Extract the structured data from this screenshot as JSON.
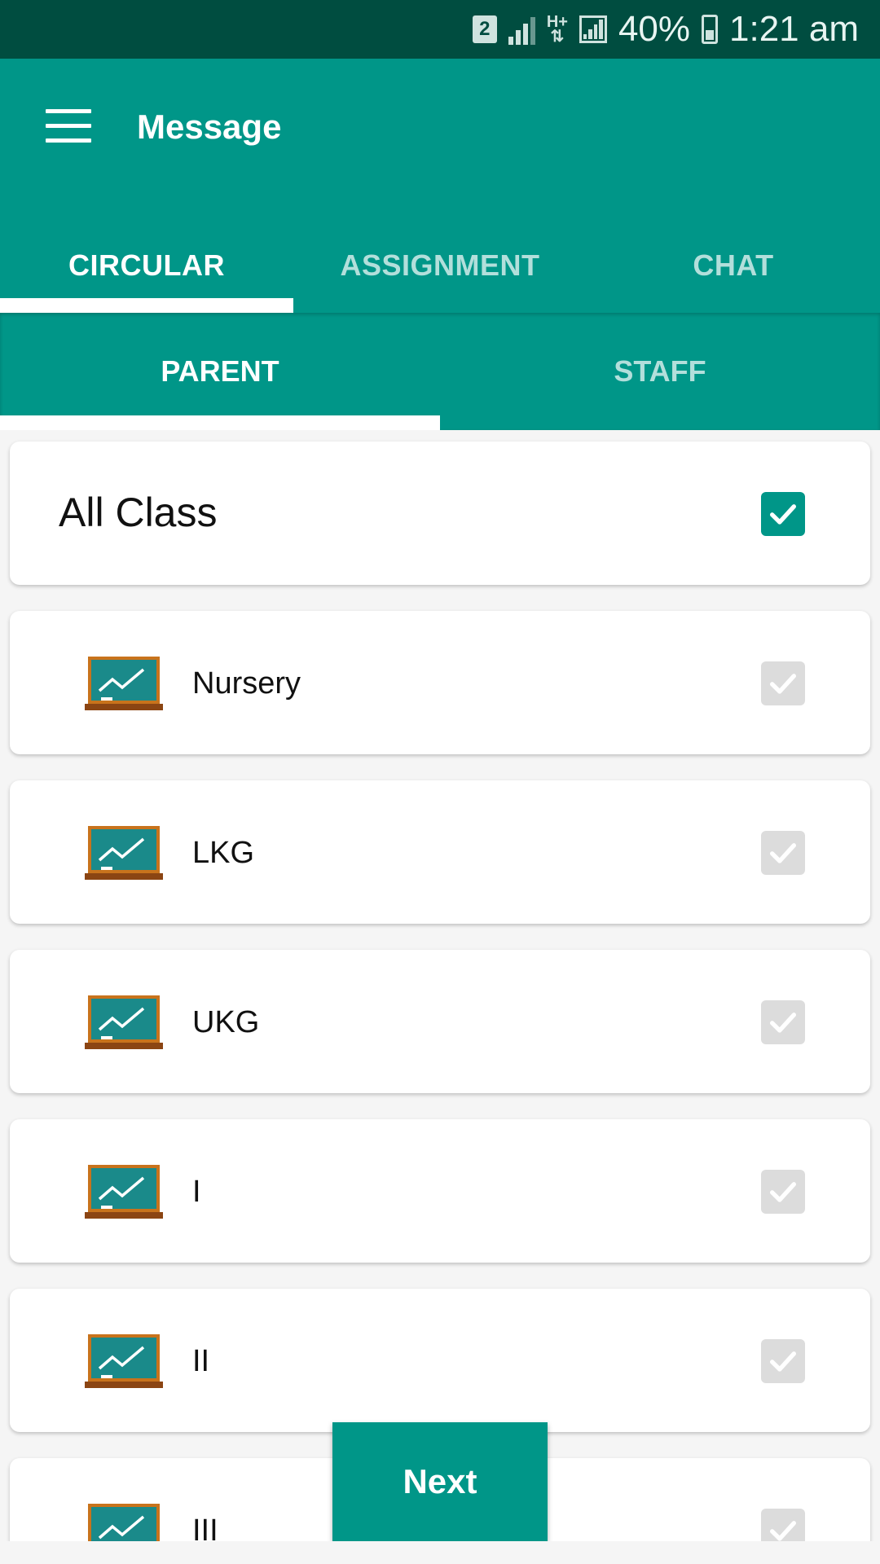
{
  "status_bar": {
    "sim": "2",
    "network_type": "H+",
    "battery": "40%",
    "time": "1:21 am"
  },
  "app_bar": {
    "title": "Message",
    "menu_icon": "hamburger-menu-icon"
  },
  "tabs": [
    {
      "label": "CIRCULAR",
      "active": true
    },
    {
      "label": "ASSIGNMENT",
      "active": false
    },
    {
      "label": "CHAT",
      "active": false
    }
  ],
  "subtabs": [
    {
      "label": "PARENT",
      "active": true
    },
    {
      "label": "STAFF",
      "active": false
    }
  ],
  "all_class": {
    "label": "All Class",
    "checked": true
  },
  "classes": [
    {
      "label": "Nursery",
      "checked": true,
      "enabled": false
    },
    {
      "label": "LKG",
      "checked": true,
      "enabled": false
    },
    {
      "label": "UKG",
      "checked": true,
      "enabled": false
    },
    {
      "label": "I",
      "checked": true,
      "enabled": false
    },
    {
      "label": "II",
      "checked": true,
      "enabled": false
    },
    {
      "label": "III",
      "checked": true,
      "enabled": false
    }
  ],
  "class_icon": "chalkboard-icon",
  "next_button": {
    "label": "Next"
  },
  "colors": {
    "primary": "#009688",
    "primary_dark": "#004d40",
    "tab_inactive": "#b2dfdb",
    "checkbox_disabled": "#dcdcdc",
    "board_green": "#1a8a8a",
    "board_frame": "#c8731c"
  }
}
